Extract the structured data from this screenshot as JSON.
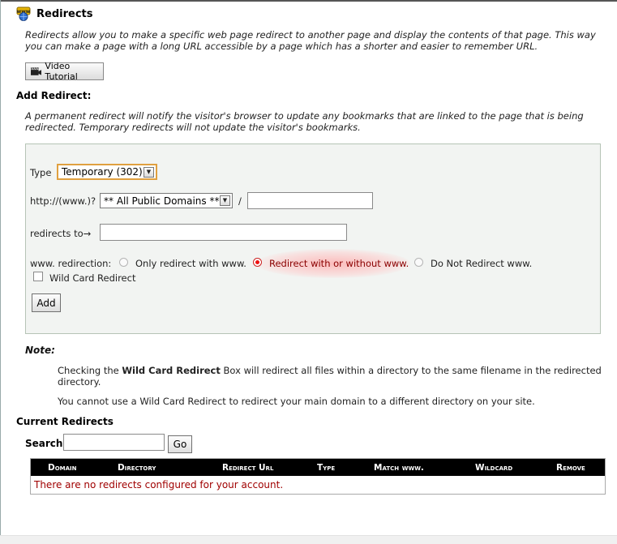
{
  "header": {
    "title": "Redirects",
    "icon": "www-globe-icon"
  },
  "intro": "Redirects allow you to make a specific web page redirect to another page and display the contents of that page. This way you can make a page with a long URL accessible by a page which has a shorter and easier to remember URL.",
  "video_button": {
    "label": "Video Tutorial",
    "icon": "camera-icon"
  },
  "add_redirect": {
    "title": "Add Redirect:",
    "description": "A permanent redirect will notify the visitor's browser to update any bookmarks that are linked to the page that is being redirected. Temporary redirects will not update the visitor's bookmarks."
  },
  "form": {
    "type_label": "Type",
    "type_value": "Temporary (302)",
    "http_label": "http://(www.)?",
    "domain_value": "** All Public Domains **",
    "slash": "/",
    "path_value": "",
    "redirects_to_label": "redirects to→",
    "redirects_to_value": "",
    "www_label": "www. redirection:",
    "www_options": [
      "Only redirect with www.",
      "Redirect with or without www.",
      "Do Not Redirect www."
    ],
    "www_selected": 1,
    "wildcard_label": "Wild Card Redirect",
    "wildcard_checked": false,
    "add_button": "Add"
  },
  "note": {
    "title": "Note:",
    "p1_before": "Checking the ",
    "p1_bold": "Wild Card Redirect",
    "p1_after": " Box will redirect all files within a directory to the same filename in the redirected directory.",
    "p2": "You cannot use a Wild Card Redirect to redirect your main domain to a different directory on your site."
  },
  "current": {
    "title": "Current Redirects",
    "search_label": "Search",
    "search_value": "",
    "go_button": "Go",
    "columns": [
      "Domain",
      "Directory",
      "Redirect Url",
      "Type",
      "Match www.",
      "Wildcard",
      "Remove"
    ],
    "empty_message": "There are no redirects configured for your account."
  },
  "colors": {
    "empty_text": "#a00000",
    "header_bg": "#000000",
    "radio_selected": "#e11111"
  }
}
